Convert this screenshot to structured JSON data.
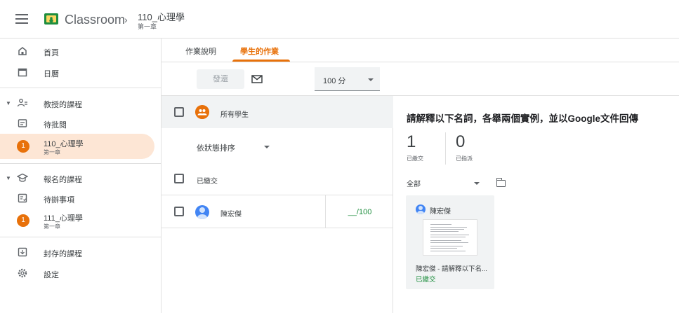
{
  "header": {
    "brand": "Classroom",
    "separator": "›",
    "course_title": "110_心理學",
    "course_subtitle": "第一章"
  },
  "sidebar": {
    "home": "首頁",
    "calendar": "日曆",
    "teaching": "教授的課程",
    "to_review": "待批閱",
    "teach_course": {
      "avatar": "1",
      "title": "110_心理學",
      "subtitle": "第一章"
    },
    "enrolled": "報名的課程",
    "todo": "待辦事項",
    "enrolled_course": {
      "avatar": "1",
      "title": "111_心理學",
      "subtitle": "第一章"
    },
    "archived": "封存的課程",
    "settings": "設定"
  },
  "tabs": {
    "instructions": "作業說明",
    "student_work": "學生的作業",
    "active": "student_work"
  },
  "toolbar": {
    "return_label": "發還",
    "score": "100 分"
  },
  "list": {
    "all_students": "所有學生",
    "sort_label": "依狀態排序",
    "section_turned_in": "已繳交",
    "students": [
      {
        "name": "陳宏傑",
        "grade": "__/100"
      }
    ]
  },
  "detail": {
    "title": "請解釋以下名詞，各舉兩個實例，並以Google文件回傳",
    "turned_in_count": "1",
    "turned_in_label": "已繳交",
    "assigned_count": "0",
    "assigned_label": "已指派",
    "filter": "全部",
    "card": {
      "name": "陳宏傑",
      "file": "陳宏傑 - 請解釋以下名...",
      "status": "已繳交"
    }
  },
  "colors": {
    "accent": "#e8710a",
    "turned_in_green": "#1e8e3e",
    "active_course_bg": "#fde6d5"
  }
}
